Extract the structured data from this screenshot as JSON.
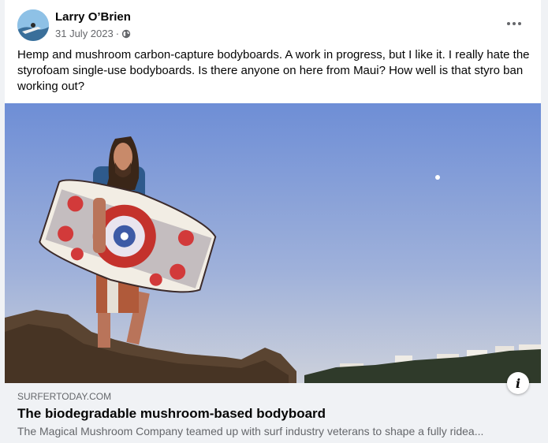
{
  "post": {
    "author": "Larry O’Brien",
    "date": "31 July 2023",
    "separator": " · ",
    "privacy_icon": "globe-icon",
    "more_icon": "more-options-icon",
    "text": "Hemp and mushroom carbon-capture bodyboards.  A work in progress, but I like it.  I really hate the styrofoam single-use bodyboards.  Is there anyone on here from Maui?  How well is that styro ban working out?"
  },
  "link_preview": {
    "domain": "SURFERTODAY.COM",
    "title": "The biodegradable mushroom-based bodyboard",
    "description": "The Magical Mushroom Company teamed up with surf industry veterans to shape a fully ridea...",
    "info_icon": "info-icon",
    "info_glyph": "i"
  },
  "colors": {
    "sky_top": "#6f8fd6",
    "sky_bottom": "#c9cfdc",
    "rock": "#5b4532",
    "text_secondary": "#65676b",
    "footer_bg": "#f0f2f5"
  }
}
